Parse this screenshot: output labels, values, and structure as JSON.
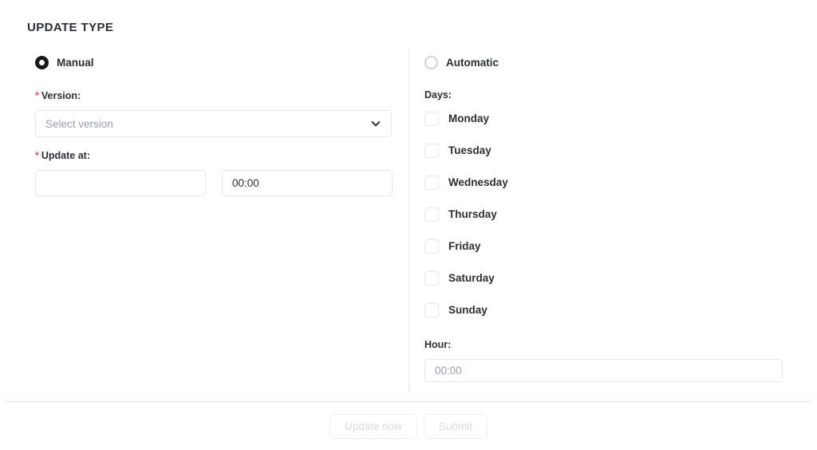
{
  "section": {
    "title": "UPDATE TYPE"
  },
  "manual": {
    "radio_label": "Manual",
    "radio_selected": true,
    "version": {
      "label": "Version:",
      "required_marker": "*",
      "placeholder": "Select version",
      "value": "",
      "chevron_icon": "chevron-down-icon"
    },
    "update_at": {
      "label": "Update at:",
      "required_marker": "*",
      "date_value": "",
      "date_placeholder": "",
      "time_value": "00:00"
    }
  },
  "automatic": {
    "radio_label": "Automatic",
    "radio_selected": false,
    "days": {
      "label": "Days:",
      "items": [
        {
          "label": "Monday",
          "checked": false
        },
        {
          "label": "Tuesday",
          "checked": false
        },
        {
          "label": "Wednesday",
          "checked": false
        },
        {
          "label": "Thursday",
          "checked": false
        },
        {
          "label": "Friday",
          "checked": false
        },
        {
          "label": "Saturday",
          "checked": false
        },
        {
          "label": "Sunday",
          "checked": false
        }
      ]
    },
    "hour": {
      "label": "Hour:",
      "value": "",
      "placeholder": "00:00"
    }
  },
  "footer": {
    "update_now_label": "Update now",
    "update_now_disabled": true,
    "submit_label": "Submit",
    "submit_disabled": true
  },
  "colors": {
    "required_star": "#f2536d",
    "text": "#2b2f36",
    "placeholder": "#9aa0a8",
    "border": "#e4e6e9",
    "divider": "#e6e8ea",
    "disabled_text": "#d9dbdf",
    "radio_selected": "#16181c"
  }
}
